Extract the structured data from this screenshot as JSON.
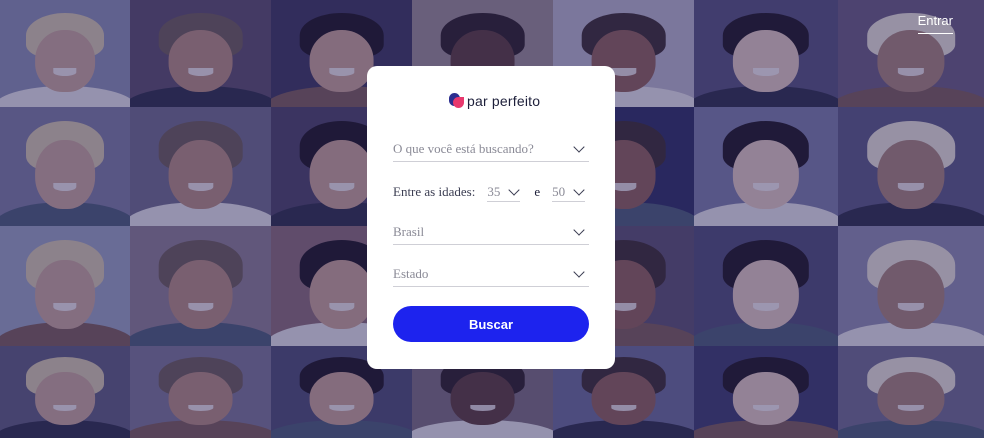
{
  "header": {
    "login_label": "Entrar"
  },
  "brand": {
    "name": "par perfeito",
    "colors": {
      "mark_blue": "#2b2e8f",
      "mark_pink": "#e8396e",
      "button": "#1d23ee"
    }
  },
  "search": {
    "looking_for": {
      "placeholder": "O que você está buscando?"
    },
    "ages": {
      "label": "Entre as idades:",
      "min": "35",
      "separator": "e",
      "max": "50"
    },
    "country": {
      "value": "Brasil"
    },
    "state": {
      "placeholder": "Estado"
    },
    "submit_label": "Buscar"
  },
  "background": {
    "icon": "people-photo-mosaic"
  }
}
